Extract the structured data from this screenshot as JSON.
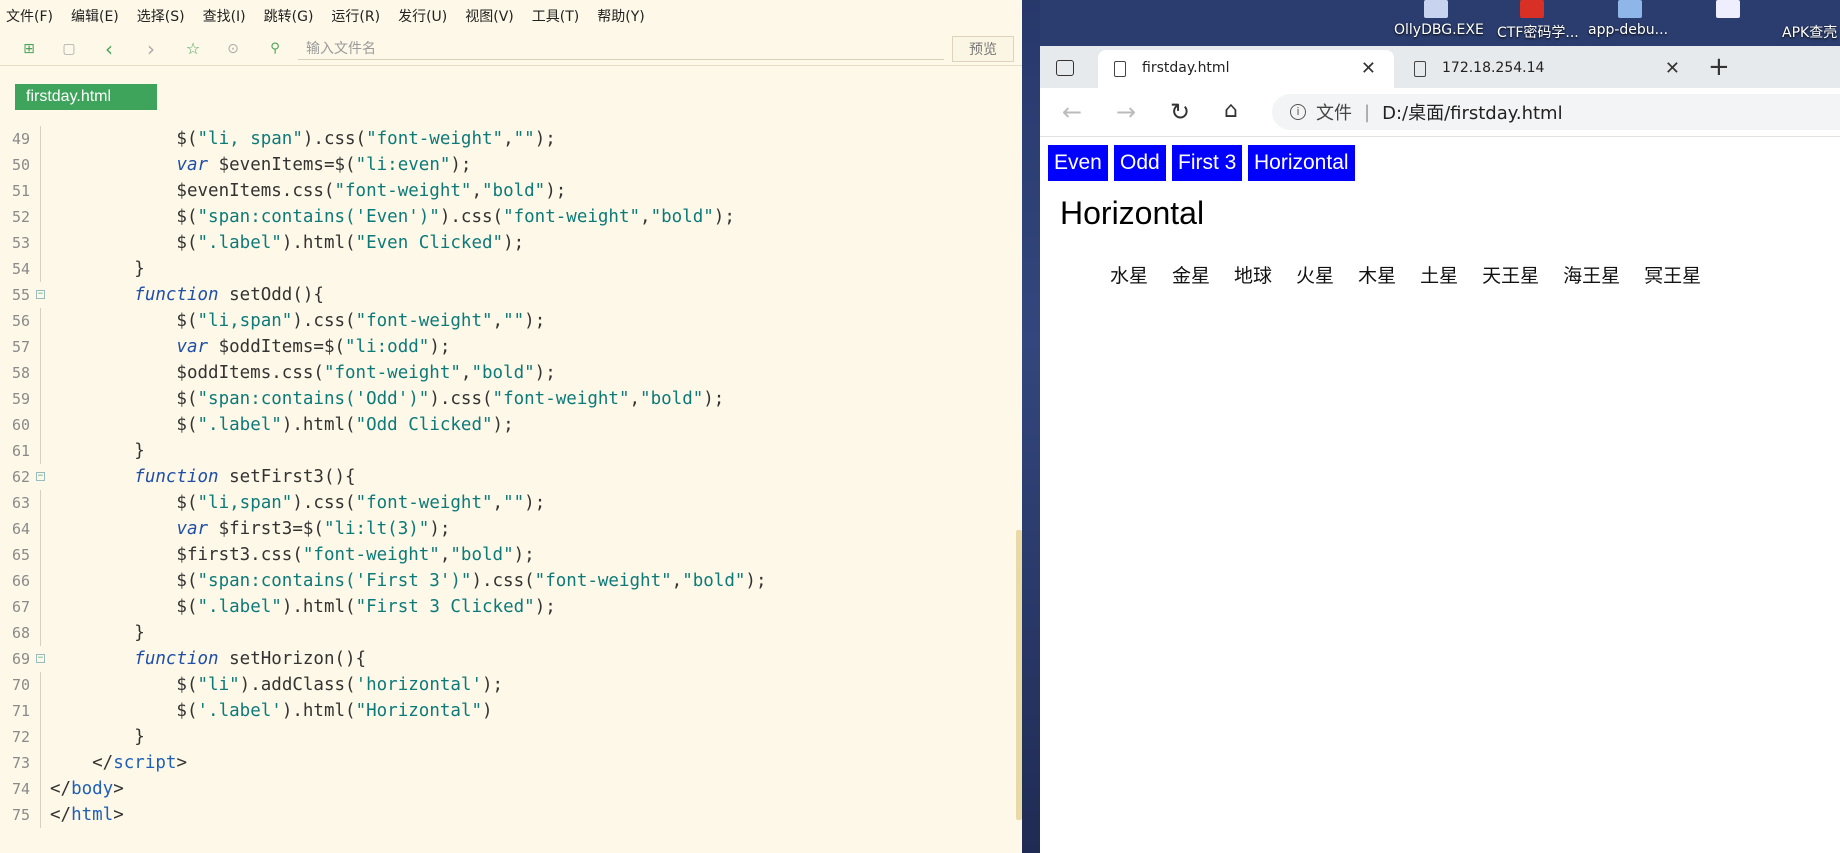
{
  "editor": {
    "menu": [
      "文件(F)",
      "编辑(E)",
      "选择(S)",
      "查找(I)",
      "跳转(G)",
      "运行(R)",
      "发行(U)",
      "视图(V)",
      "工具(T)",
      "帮助(Y)"
    ],
    "search_placeholder": "输入文件名",
    "preview_label": "预览",
    "file_tab": "firstday.html",
    "code_lines": [
      {
        "num": "49",
        "fold": false,
        "html": "            $(<span class=\"s\">\"li, span\"</span>).css(<span class=\"s\">\"font-weight\"</span>,<span class=\"s\">\"\"</span>);"
      },
      {
        "num": "50",
        "fold": false,
        "html": "            <span class=\"k\">var</span> $evenItems=$(<span class=\"s\">\"li:even\"</span>);"
      },
      {
        "num": "51",
        "fold": false,
        "html": "            $evenItems.css(<span class=\"s\">\"font-weight\"</span>,<span class=\"s\">\"bold\"</span>);"
      },
      {
        "num": "52",
        "fold": false,
        "html": "            $(<span class=\"s\">\"span:contains('Even')\"</span>).css(<span class=\"s\">\"font-weight\"</span>,<span class=\"s\">\"bold\"</span>);"
      },
      {
        "num": "53",
        "fold": false,
        "html": "            $(<span class=\"s\">\".label\"</span>).html(<span class=\"s\">\"Even Clicked\"</span>);"
      },
      {
        "num": "54",
        "fold": false,
        "html": "        }"
      },
      {
        "num": "55",
        "fold": true,
        "html": "        <span class=\"k\">function</span> setOdd(){"
      },
      {
        "num": "56",
        "fold": false,
        "html": "            $(<span class=\"s\">\"li,span\"</span>).css(<span class=\"s\">\"font-weight\"</span>,<span class=\"s\">\"\"</span>);"
      },
      {
        "num": "57",
        "fold": false,
        "html": "            <span class=\"k\">var</span> $oddItems=$(<span class=\"s\">\"li:odd\"</span>);"
      },
      {
        "num": "58",
        "fold": false,
        "html": "            $oddItems.css(<span class=\"s\">\"font-weight\"</span>,<span class=\"s\">\"bold\"</span>);"
      },
      {
        "num": "59",
        "fold": false,
        "html": "            $(<span class=\"s\">\"span:contains('Odd')\"</span>).css(<span class=\"s\">\"font-weight\"</span>,<span class=\"s\">\"bold\"</span>);"
      },
      {
        "num": "60",
        "fold": false,
        "html": "            $(<span class=\"s\">\".label\"</span>).html(<span class=\"s\">\"Odd Clicked\"</span>);"
      },
      {
        "num": "61",
        "fold": false,
        "html": "        }"
      },
      {
        "num": "62",
        "fold": true,
        "html": "        <span class=\"k\">function</span> setFirst3(){"
      },
      {
        "num": "63",
        "fold": false,
        "html": "            $(<span class=\"s\">\"li,span\"</span>).css(<span class=\"s\">\"font-weight\"</span>,<span class=\"s\">\"\"</span>);"
      },
      {
        "num": "64",
        "fold": false,
        "html": "            <span class=\"k\">var</span> $first3=$(<span class=\"s\">\"li:lt(3)\"</span>);"
      },
      {
        "num": "65",
        "fold": false,
        "html": "            $first3.css(<span class=\"s\">\"font-weight\"</span>,<span class=\"s\">\"bold\"</span>);"
      },
      {
        "num": "66",
        "fold": false,
        "html": "            $(<span class=\"s\">\"span:contains('First 3')\"</span>).css(<span class=\"s\">\"font-weight\"</span>,<span class=\"s\">\"bold\"</span>);"
      },
      {
        "num": "67",
        "fold": false,
        "html": "            $(<span class=\"s\">\".label\"</span>).html(<span class=\"s\">\"First 3 Clicked\"</span>);"
      },
      {
        "num": "68",
        "fold": false,
        "html": "        }"
      },
      {
        "num": "69",
        "fold": true,
        "html": "        <span class=\"k\">function</span> setHorizon(){"
      },
      {
        "num": "70",
        "fold": false,
        "html": "            $(<span class=\"s\">\"li\"</span>).addClass(<span class=\"s\">'horizontal'</span>);"
      },
      {
        "num": "71",
        "fold": false,
        "html": "            $(<span class=\"s\">'.label'</span>).html(<span class=\"s\">\"Horizontal\"</span>)"
      },
      {
        "num": "72",
        "fold": false,
        "html": "        }"
      },
      {
        "num": "73",
        "fold": false,
        "html": "    &lt;/<span class=\"t\">script</span>&gt;"
      },
      {
        "num": "74",
        "fold": false,
        "html": "&lt;/<span class=\"t\">body</span>&gt;"
      },
      {
        "num": "75",
        "fold": false,
        "html": "&lt;/<span class=\"t\">html</span>&gt;"
      }
    ]
  },
  "desktop": {
    "labels": [
      "OllyDBG.EXE",
      "CTF密码学...",
      "app-debu...",
      "APK查壳"
    ]
  },
  "browser": {
    "tabs": [
      {
        "label": "firstday.html",
        "close": "✕"
      },
      {
        "label": "172.18.254.14",
        "close": "✕"
      }
    ],
    "new_tab": "+",
    "url_prefix": "文件",
    "url": "D:/桌面/firstday.html",
    "page": {
      "buttons": [
        "Even",
        "Odd",
        "First 3",
        "Horizontal"
      ],
      "label": "Horizontal",
      "planets": [
        "水星",
        "金星",
        "地球",
        "火星",
        "木星",
        "土星",
        "天王星",
        "海王星",
        "冥王星"
      ]
    }
  }
}
